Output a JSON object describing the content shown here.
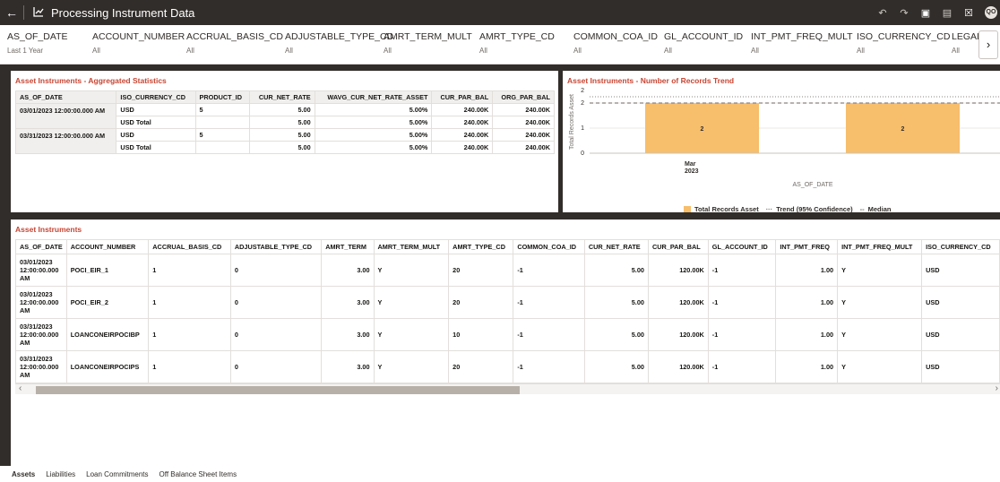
{
  "header": {
    "title": "Processing Instrument Data",
    "back_icon": "arrow-left-icon",
    "app_icon": "chart-icon",
    "actions": [
      "undo-icon",
      "redo-icon",
      "save-icon",
      "present-icon",
      "close-icon"
    ],
    "avatar": "QO"
  },
  "filters": [
    {
      "name": "AS_OF_DATE",
      "value": "Last 1 Year"
    },
    {
      "name": "ACCOUNT_NUMBER",
      "value": "All"
    },
    {
      "name": "ACCRUAL_BASIS_CD",
      "value": "All"
    },
    {
      "name": "ADJUSTABLE_TYPE_CD",
      "value": "All"
    },
    {
      "name": "AMRT_TERM_MULT",
      "value": "All"
    },
    {
      "name": "AMRT_TYPE_CD",
      "value": "All"
    },
    {
      "name": "COMMON_COA_ID",
      "value": "All"
    },
    {
      "name": "GL_ACCOUNT_ID",
      "value": "All"
    },
    {
      "name": "INT_PMT_FREQ_MULT",
      "value": "All"
    },
    {
      "name": "ISO_CURRENCY_CD",
      "value": "All"
    },
    {
      "name": "LEGAL",
      "value": "All"
    }
  ],
  "agg_panel": {
    "title": "Asset Instruments - Aggregated Statistics",
    "columns": [
      "AS_OF_DATE",
      "ISO_CURRENCY_CD",
      "PRODUCT_ID",
      "CUR_NET_RATE",
      "WAVG_CUR_NET_RATE_ASSET",
      "CUR_PAR_BAL",
      "ORG_PAR_BAL"
    ],
    "groups": [
      {
        "date": "03/01/2023 12:00:00.000 AM",
        "rows": [
          {
            "currency": "USD",
            "product": "5",
            "rate": "5.00",
            "wavg": "5.00%",
            "cur_par": "240.00K",
            "org_par": "240.00K"
          },
          {
            "currency": "USD Total",
            "product": "",
            "rate": "5.00",
            "wavg": "5.00%",
            "cur_par": "240.00K",
            "org_par": "240.00K"
          }
        ]
      },
      {
        "date": "03/31/2023 12:00:00.000 AM",
        "rows": [
          {
            "currency": "USD",
            "product": "5",
            "rate": "5.00",
            "wavg": "5.00%",
            "cur_par": "240.00K",
            "org_par": "240.00K"
          },
          {
            "currency": "USD Total",
            "product": "",
            "rate": "5.00",
            "wavg": "5.00%",
            "cur_par": "240.00K",
            "org_par": "240.00K"
          }
        ]
      }
    ]
  },
  "trend_panel": {
    "title": "Asset Instruments - Number of Records Trend",
    "legend": {
      "bar": "Total Records Asset",
      "trend": "Trend (95% Confidence)",
      "median": "Median"
    }
  },
  "chart_data": {
    "type": "bar",
    "title": "Asset Instruments - Number of Records Trend",
    "categories": [
      "Mar 2023 (1)",
      "Mar 2023 (2)"
    ],
    "category_tick_label": [
      "Mar",
      "2023"
    ],
    "series": [
      {
        "name": "Total Records Asset",
        "values": [
          2,
          2
        ],
        "color": "#f7be6b"
      }
    ],
    "data_labels": [
      "2",
      "2"
    ],
    "y_ticks": [
      "0",
      "1",
      "2",
      "2"
    ],
    "ylabel": "Total Records Asset",
    "xlabel": "AS_OF_DATE",
    "ylim": [
      0,
      2.5
    ],
    "median": 2,
    "trend": 2,
    "legend_position": "bottom",
    "grid": true
  },
  "inst_panel": {
    "title": "Asset Instruments",
    "columns": [
      "AS_OF_DATE",
      "ACCOUNT_NUMBER",
      "ACCRUAL_BASIS_CD",
      "ADJUSTABLE_TYPE_CD",
      "AMRT_TERM",
      "AMRT_TERM_MULT",
      "AMRT_TYPE_CD",
      "COMMON_COA_ID",
      "CUR_NET_RATE",
      "CUR_PAR_BAL",
      "GL_ACCOUNT_ID",
      "INT_PMT_FREQ",
      "INT_PMT_FREQ_MULT",
      "ISO_CURRENCY_CD"
    ],
    "rows": [
      [
        "03/01/2023 12:00:00.000 AM",
        "POCI_EIR_1",
        "1",
        "0",
        "3.00",
        "Y",
        "20",
        "-1",
        "5.00",
        "120.00K",
        "-1",
        "1.00",
        "Y",
        "USD"
      ],
      [
        "03/01/2023 12:00:00.000 AM",
        "POCI_EIR_2",
        "1",
        "0",
        "3.00",
        "Y",
        "20",
        "-1",
        "5.00",
        "120.00K",
        "-1",
        "1.00",
        "Y",
        "USD"
      ],
      [
        "03/31/2023 12:00:00.000 AM",
        "LOANCONEIRPOCIBP",
        "1",
        "0",
        "3.00",
        "Y",
        "10",
        "-1",
        "5.00",
        "120.00K",
        "-1",
        "1.00",
        "Y",
        "USD"
      ],
      [
        "03/31/2023 12:00:00.000 AM",
        "LOANCONEIRPOCIPS",
        "1",
        "0",
        "3.00",
        "Y",
        "20",
        "-1",
        "5.00",
        "120.00K",
        "-1",
        "1.00",
        "Y",
        "USD"
      ]
    ]
  },
  "bottom_tabs": [
    {
      "label": "Assets",
      "active": true
    },
    {
      "label": "Liabilities",
      "active": false
    },
    {
      "label": "Loan Commitments",
      "active": false
    },
    {
      "label": "Off Balance Sheet Items",
      "active": false
    }
  ]
}
